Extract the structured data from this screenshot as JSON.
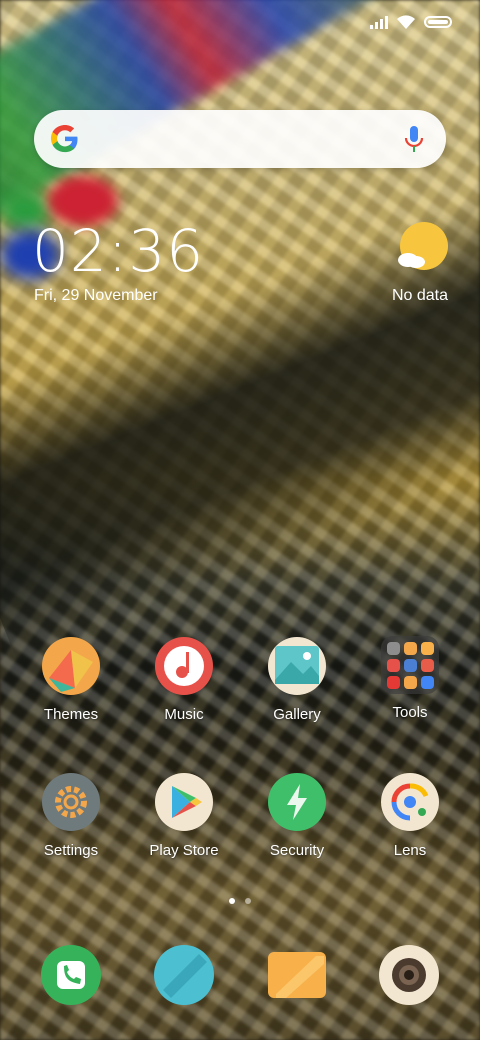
{
  "status_bar": {
    "signal_level": 4,
    "wifi": "wifi-icon",
    "battery_level": 1.0
  },
  "search": {
    "logo": "google-g-icon",
    "mic": "microphone-icon"
  },
  "clock": {
    "time": "02:36",
    "date": "Fri, 29 November"
  },
  "weather": {
    "icon": "sun-cloud-icon",
    "label": "No data"
  },
  "apps_row1": [
    {
      "label": "Themes",
      "icon": "themes-icon"
    },
    {
      "label": "Music",
      "icon": "music-icon"
    },
    {
      "label": "Gallery",
      "icon": "gallery-icon"
    },
    {
      "label": "Tools",
      "icon": "folder-icon"
    }
  ],
  "apps_row2": [
    {
      "label": "Settings",
      "icon": "settings-icon"
    },
    {
      "label": "Play Store",
      "icon": "play-store-icon"
    },
    {
      "label": "Security",
      "icon": "security-icon"
    },
    {
      "label": "Lens",
      "icon": "lens-icon"
    }
  ],
  "page_indicator": {
    "pages": 2,
    "current": 1
  },
  "dock": [
    {
      "icon": "phone-icon"
    },
    {
      "icon": "messages-icon"
    },
    {
      "icon": "browser-icon"
    },
    {
      "icon": "camera-icon"
    }
  ],
  "colors": {
    "themes_bg": "#f4a64a",
    "music_bg": "#e6524a",
    "gallery_bg": "#5ec5c8",
    "settings_bg": "#6f7a7d",
    "security_bg": "#3fbf6a",
    "phone_bg": "#36b35a",
    "messages_bg": "#4cbfd1",
    "browser_bg": "#f8b14a",
    "camera_bg": "#f3e6d0"
  }
}
